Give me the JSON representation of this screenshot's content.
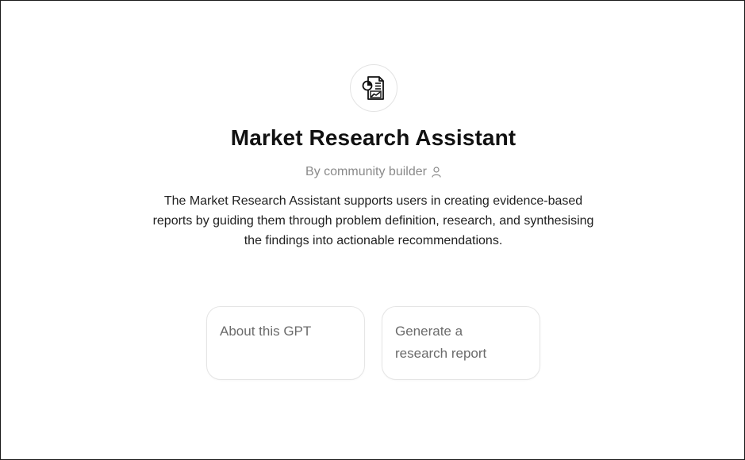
{
  "gpt": {
    "logo_icon": "report-chart-icon",
    "title": "Market Research Assistant",
    "byline": "By community builder",
    "byline_icon": "person-icon",
    "description": "The Market Research Assistant supports users in creating evidence-based reports by guiding them through problem definition, research, and synthesising the findings into actionable recommendations."
  },
  "starters": [
    {
      "label": "About this GPT"
    },
    {
      "label": "Generate a research report"
    }
  ],
  "colors": {
    "title": "#111111",
    "byline": "#8a8a8a",
    "body_text": "#1f1f1f",
    "starter_text": "#6b6b6b",
    "card_border": "#e5e5e5"
  }
}
